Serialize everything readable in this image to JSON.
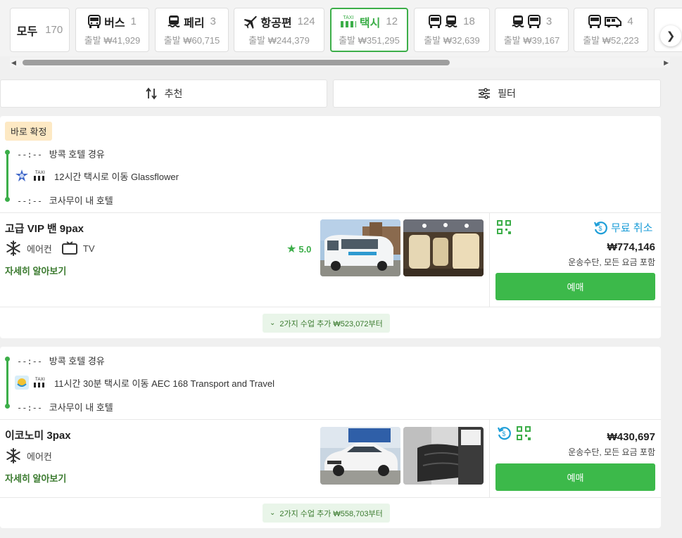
{
  "tabs": [
    {
      "name": "모두",
      "count": "170",
      "price": ""
    },
    {
      "name": "버스",
      "count": "1",
      "price": "출발 ₩41,929"
    },
    {
      "name": "페리",
      "count": "3",
      "price": "출발 ₩60,715"
    },
    {
      "name": "항공편",
      "count": "124",
      "price": "출발 ₩244,379"
    },
    {
      "name": "택시",
      "count": "12",
      "price": "출발 ₩351,295",
      "active": true
    },
    {
      "name": "",
      "count": "18",
      "price": "출발 ₩32,639"
    },
    {
      "name": "",
      "count": "3",
      "price": "출발 ₩39,167"
    },
    {
      "name": "",
      "count": "4",
      "price": "출발 ₩52,223"
    }
  ],
  "taxi_badge": "TAXI",
  "sort_label": "추천",
  "filter_label": "필터",
  "results": [
    {
      "badge": "바로 확정",
      "depart_time": "--:--",
      "depart_place": "방콕 호텔 경유",
      "trip_text": "12시간 택시로 이동 Glassflower",
      "arrive_time": "--:--",
      "arrive_place": "코사무이 내 호텔",
      "vehicle": "고급 VIP 밴 9pax",
      "amenities": [
        "에어컨",
        "TV"
      ],
      "rating": "5.0",
      "more": "자세히 알아보기",
      "free_cancel": "무료 취소",
      "price": "₩774,146",
      "price_note": "운송수단, 모든 요금 포함",
      "book": "예매",
      "extra_classes": "2가지 수업 추가 ₩523,072부터"
    },
    {
      "depart_time": "--:--",
      "depart_place": "방콕 호텔 경유",
      "trip_text": "11시간 30분 택시로 이동 AEC 168 Transport and Travel",
      "arrive_time": "--:--",
      "arrive_place": "코사무이 내 호텔",
      "vehicle": "이코노미 3pax",
      "amenities": [
        "에어컨"
      ],
      "more": "자세히 알아보기",
      "price": "₩430,697",
      "price_note": "운송수단, 모든 요금 포함",
      "book": "예매",
      "extra_classes": "2가지 수업 추가 ₩558,703부터"
    }
  ],
  "colors": {
    "accent": "#3cae49",
    "cancel_blue": "#1e9ed8",
    "badge_bg": "#fde9c4"
  }
}
